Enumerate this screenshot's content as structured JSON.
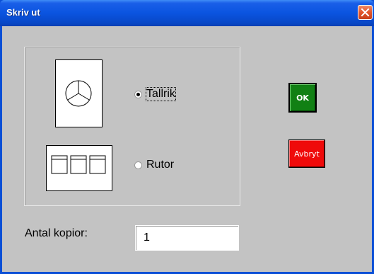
{
  "window": {
    "title": "Skriv ut"
  },
  "print_mode": {
    "options": [
      {
        "label": "Tallrik",
        "selected": true,
        "icon": "pie-chart-icon"
      },
      {
        "label": "Rutor",
        "selected": false,
        "icon": "grid-tiles-icon"
      }
    ]
  },
  "buttons": {
    "ok_label": "OK",
    "cancel_label": "Avbryt"
  },
  "copies": {
    "label": "Antal kopior:",
    "value": "1"
  },
  "colors": {
    "ok_button": "#118014",
    "cancel_button": "#ef0a0a",
    "titlebar": "#0a54e0",
    "dialog_background": "#c3c3c3"
  }
}
